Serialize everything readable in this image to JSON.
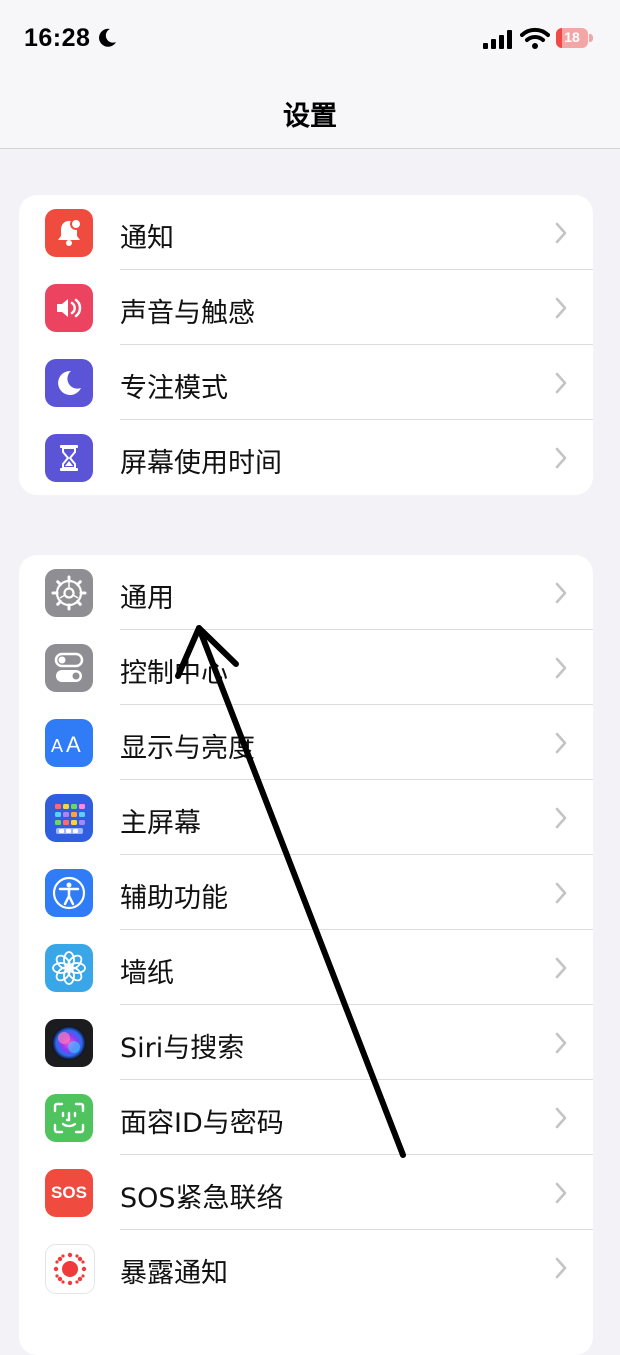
{
  "status_bar": {
    "time": "16:28",
    "battery": "18",
    "battery_level": 0.18
  },
  "nav": {
    "title": "设置"
  },
  "group1": [
    {
      "label": "通知",
      "icon": "bell-icon",
      "color": "#ef4b3f"
    },
    {
      "label": "声音与触感",
      "icon": "speaker-icon",
      "color": "#ec4460"
    },
    {
      "label": "专注模式",
      "icon": "moon-icon",
      "color": "#5b54d6"
    },
    {
      "label": "屏幕使用时间",
      "icon": "hourglass-icon",
      "color": "#5b54d6"
    }
  ],
  "group2": [
    {
      "label": "通用",
      "icon": "gear-icon",
      "color": "#8e8e93"
    },
    {
      "label": "控制中心",
      "icon": "toggles-icon",
      "color": "#8e8e93"
    },
    {
      "label": "显示与亮度",
      "icon": "text-size-icon",
      "color": "#2f7cf6"
    },
    {
      "label": "主屏幕",
      "icon": "home-grid-icon",
      "color": "#2f5fe0"
    },
    {
      "label": "辅助功能",
      "icon": "accessibility-icon",
      "color": "#2f7cf6"
    },
    {
      "label": "墙纸",
      "icon": "flower-icon",
      "color": "#39a6e8"
    },
    {
      "label": "Siri与搜索",
      "icon": "siri-icon",
      "color": "#1c1c1e"
    },
    {
      "label": "面容ID与密码",
      "icon": "face-id-icon",
      "color": "#4fc35d"
    },
    {
      "label": "SOS紧急联络",
      "icon": "sos-icon",
      "color": "#ef4b3f",
      "icon_text": "SOS"
    },
    {
      "label": "暴露通知",
      "icon": "exposure-icon",
      "color": "#ffffff"
    }
  ]
}
